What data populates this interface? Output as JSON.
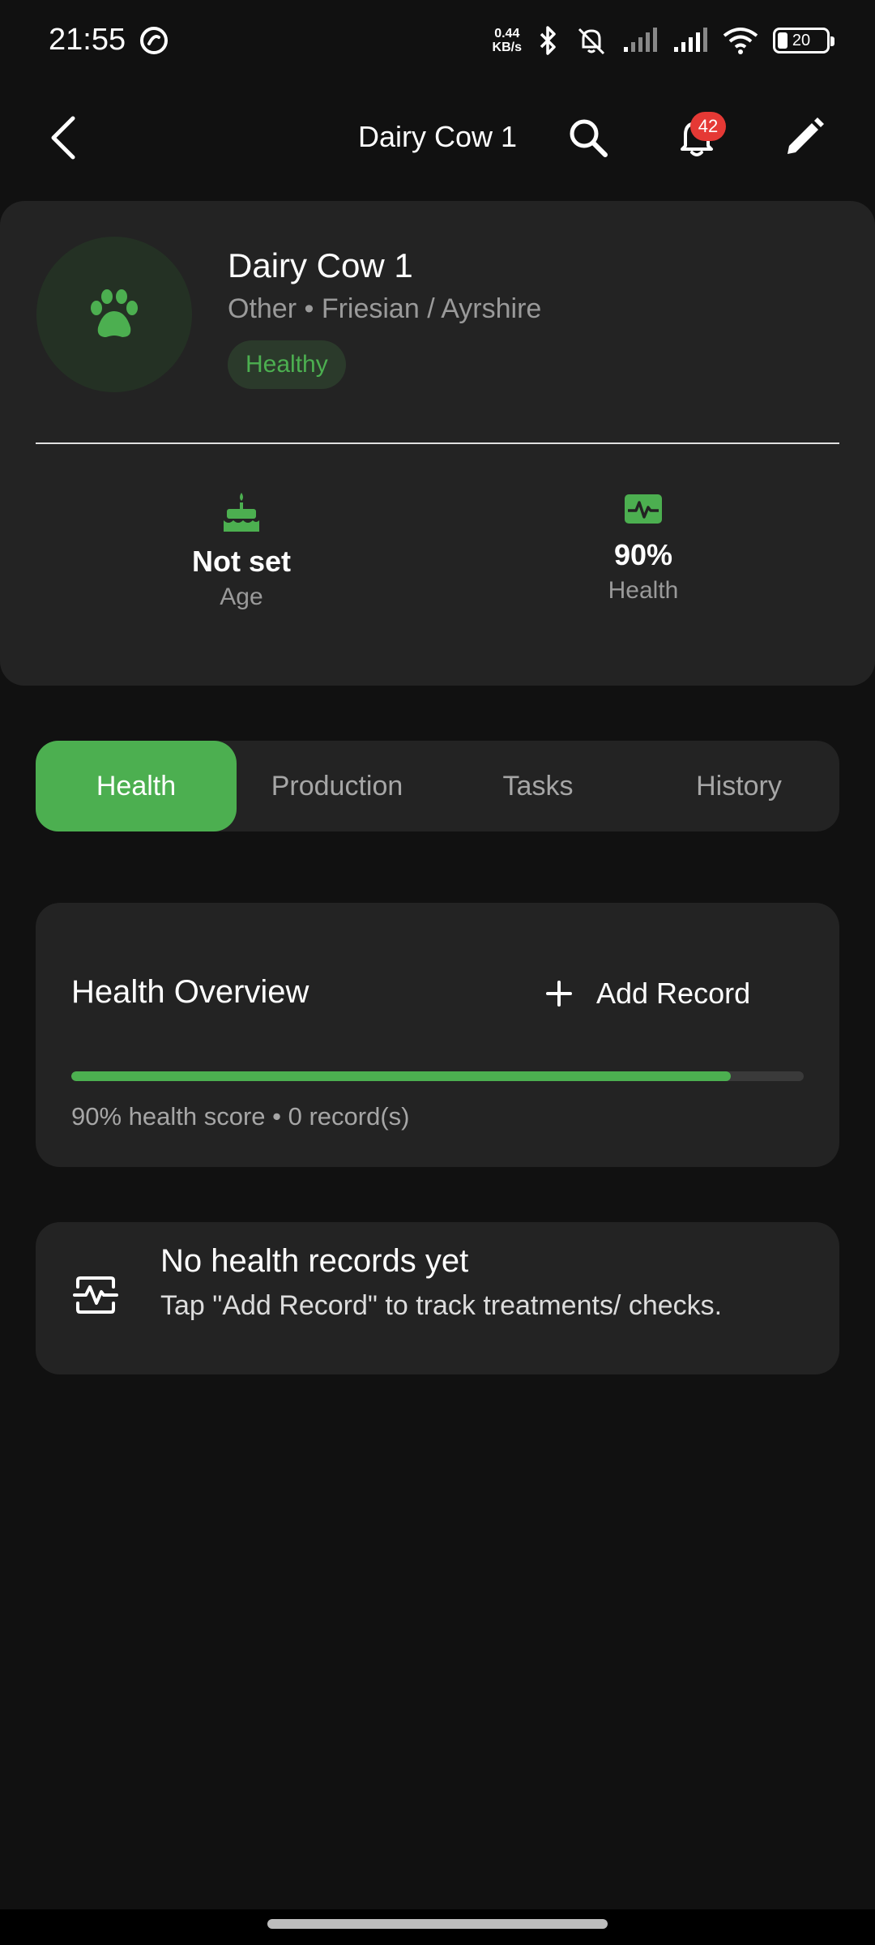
{
  "status_bar": {
    "time": "21:55",
    "net_speed_value": "0.44",
    "net_speed_unit": "KB/s",
    "battery": "20"
  },
  "app_bar": {
    "title": "Dairy Cow 1",
    "notification_count": "42"
  },
  "animal": {
    "name": "Dairy Cow 1",
    "subtitle": "Other • Friesian / Ayrshire",
    "status": "Healthy",
    "stats": {
      "age_value": "Not set",
      "age_label": "Age",
      "health_value": "90%",
      "health_label": "Health"
    }
  },
  "tabs": [
    {
      "label": "Health",
      "active": true
    },
    {
      "label": "Production",
      "active": false
    },
    {
      "label": "Tasks",
      "active": false
    },
    {
      "label": "History",
      "active": false
    }
  ],
  "health_overview": {
    "title": "Health Overview",
    "add_label": "Add Record",
    "score_fraction": 0.9,
    "caption": "90% health score • 0 record(s)"
  },
  "empty_state": {
    "title": "No health records yet",
    "description": "Tap \"Add Record\" to track treatments/ checks."
  },
  "colors": {
    "accent": "#4caf50",
    "background": "#111111",
    "card": "#232323",
    "badge": "#e53935"
  },
  "icons": {
    "back": "arrow-left-icon",
    "search": "search-icon",
    "notifications": "bell-icon",
    "edit": "pencil-icon",
    "avatar": "paw-icon",
    "age": "cake-icon",
    "health": "heart-monitor-icon",
    "add": "plus-icon",
    "empty": "pulse-icon"
  }
}
